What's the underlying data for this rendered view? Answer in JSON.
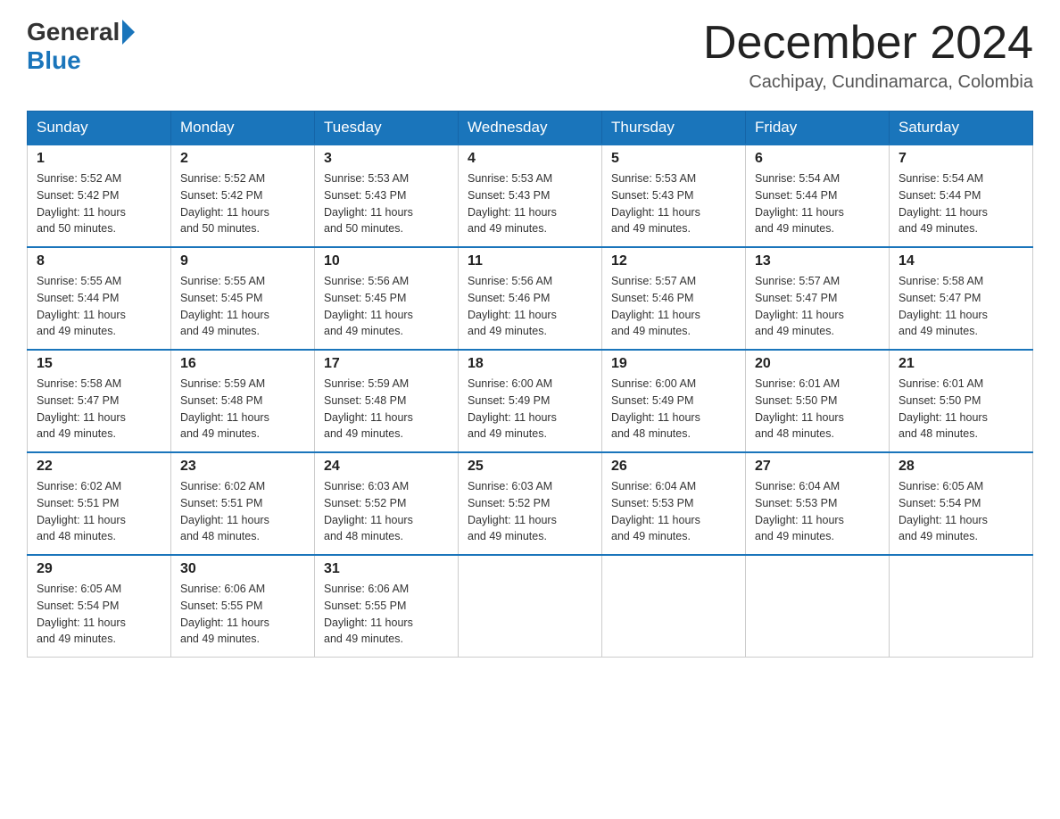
{
  "logo": {
    "general": "General",
    "blue": "Blue"
  },
  "title": "December 2024",
  "location": "Cachipay, Cundinamarca, Colombia",
  "days_of_week": [
    "Sunday",
    "Monday",
    "Tuesday",
    "Wednesday",
    "Thursday",
    "Friday",
    "Saturday"
  ],
  "weeks": [
    [
      {
        "day": "1",
        "sunrise": "5:52 AM",
        "sunset": "5:42 PM",
        "daylight": "11 hours and 50 minutes."
      },
      {
        "day": "2",
        "sunrise": "5:52 AM",
        "sunset": "5:42 PM",
        "daylight": "11 hours and 50 minutes."
      },
      {
        "day": "3",
        "sunrise": "5:53 AM",
        "sunset": "5:43 PM",
        "daylight": "11 hours and 50 minutes."
      },
      {
        "day": "4",
        "sunrise": "5:53 AM",
        "sunset": "5:43 PM",
        "daylight": "11 hours and 49 minutes."
      },
      {
        "day": "5",
        "sunrise": "5:53 AM",
        "sunset": "5:43 PM",
        "daylight": "11 hours and 49 minutes."
      },
      {
        "day": "6",
        "sunrise": "5:54 AM",
        "sunset": "5:44 PM",
        "daylight": "11 hours and 49 minutes."
      },
      {
        "day": "7",
        "sunrise": "5:54 AM",
        "sunset": "5:44 PM",
        "daylight": "11 hours and 49 minutes."
      }
    ],
    [
      {
        "day": "8",
        "sunrise": "5:55 AM",
        "sunset": "5:44 PM",
        "daylight": "11 hours and 49 minutes."
      },
      {
        "day": "9",
        "sunrise": "5:55 AM",
        "sunset": "5:45 PM",
        "daylight": "11 hours and 49 minutes."
      },
      {
        "day": "10",
        "sunrise": "5:56 AM",
        "sunset": "5:45 PM",
        "daylight": "11 hours and 49 minutes."
      },
      {
        "day": "11",
        "sunrise": "5:56 AM",
        "sunset": "5:46 PM",
        "daylight": "11 hours and 49 minutes."
      },
      {
        "day": "12",
        "sunrise": "5:57 AM",
        "sunset": "5:46 PM",
        "daylight": "11 hours and 49 minutes."
      },
      {
        "day": "13",
        "sunrise": "5:57 AM",
        "sunset": "5:47 PM",
        "daylight": "11 hours and 49 minutes."
      },
      {
        "day": "14",
        "sunrise": "5:58 AM",
        "sunset": "5:47 PM",
        "daylight": "11 hours and 49 minutes."
      }
    ],
    [
      {
        "day": "15",
        "sunrise": "5:58 AM",
        "sunset": "5:47 PM",
        "daylight": "11 hours and 49 minutes."
      },
      {
        "day": "16",
        "sunrise": "5:59 AM",
        "sunset": "5:48 PM",
        "daylight": "11 hours and 49 minutes."
      },
      {
        "day": "17",
        "sunrise": "5:59 AM",
        "sunset": "5:48 PM",
        "daylight": "11 hours and 49 minutes."
      },
      {
        "day": "18",
        "sunrise": "6:00 AM",
        "sunset": "5:49 PM",
        "daylight": "11 hours and 49 minutes."
      },
      {
        "day": "19",
        "sunrise": "6:00 AM",
        "sunset": "5:49 PM",
        "daylight": "11 hours and 48 minutes."
      },
      {
        "day": "20",
        "sunrise": "6:01 AM",
        "sunset": "5:50 PM",
        "daylight": "11 hours and 48 minutes."
      },
      {
        "day": "21",
        "sunrise": "6:01 AM",
        "sunset": "5:50 PM",
        "daylight": "11 hours and 48 minutes."
      }
    ],
    [
      {
        "day": "22",
        "sunrise": "6:02 AM",
        "sunset": "5:51 PM",
        "daylight": "11 hours and 48 minutes."
      },
      {
        "day": "23",
        "sunrise": "6:02 AM",
        "sunset": "5:51 PM",
        "daylight": "11 hours and 48 minutes."
      },
      {
        "day": "24",
        "sunrise": "6:03 AM",
        "sunset": "5:52 PM",
        "daylight": "11 hours and 48 minutes."
      },
      {
        "day": "25",
        "sunrise": "6:03 AM",
        "sunset": "5:52 PM",
        "daylight": "11 hours and 49 minutes."
      },
      {
        "day": "26",
        "sunrise": "6:04 AM",
        "sunset": "5:53 PM",
        "daylight": "11 hours and 49 minutes."
      },
      {
        "day": "27",
        "sunrise": "6:04 AM",
        "sunset": "5:53 PM",
        "daylight": "11 hours and 49 minutes."
      },
      {
        "day": "28",
        "sunrise": "6:05 AM",
        "sunset": "5:54 PM",
        "daylight": "11 hours and 49 minutes."
      }
    ],
    [
      {
        "day": "29",
        "sunrise": "6:05 AM",
        "sunset": "5:54 PM",
        "daylight": "11 hours and 49 minutes."
      },
      {
        "day": "30",
        "sunrise": "6:06 AM",
        "sunset": "5:55 PM",
        "daylight": "11 hours and 49 minutes."
      },
      {
        "day": "31",
        "sunrise": "6:06 AM",
        "sunset": "5:55 PM",
        "daylight": "11 hours and 49 minutes."
      },
      null,
      null,
      null,
      null
    ]
  ],
  "sunrise_label": "Sunrise:",
  "sunset_label": "Sunset:",
  "daylight_label": "Daylight:"
}
